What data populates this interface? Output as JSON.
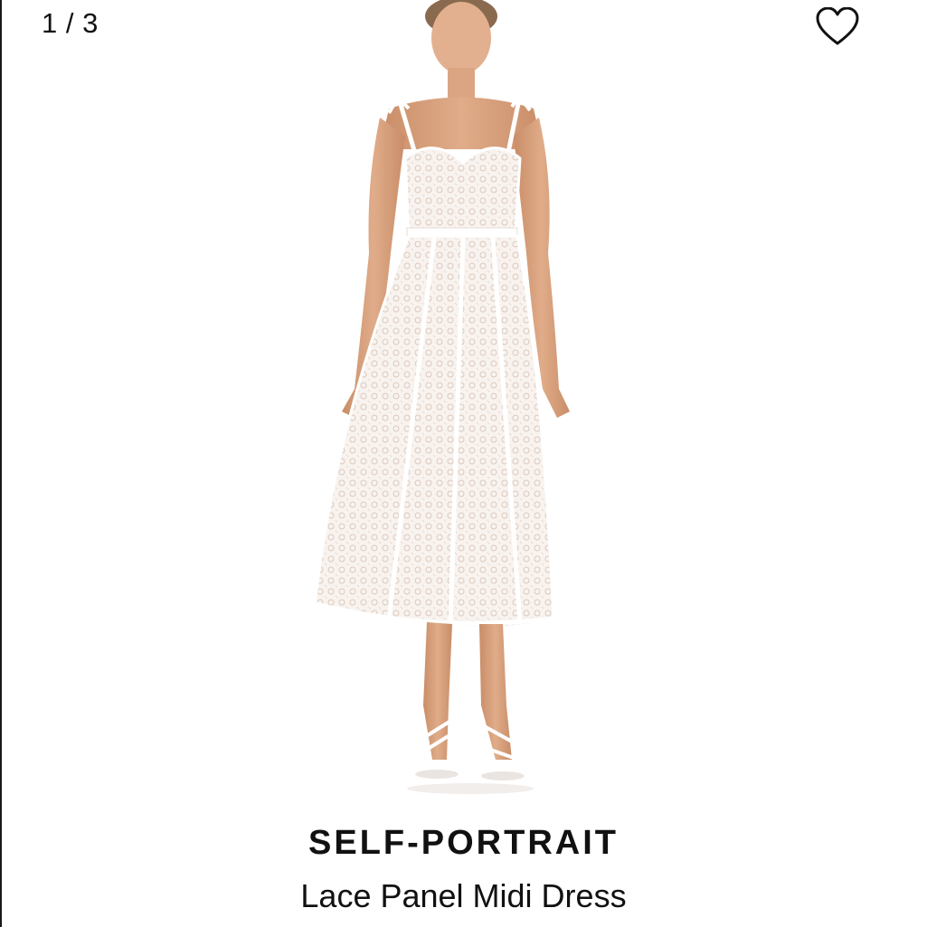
{
  "gallery": {
    "counter": "1 / 3"
  },
  "wishlist": {
    "icon": "heart-outline-icon"
  },
  "product": {
    "brand": "SELF-PORTRAIT",
    "name": "Lace Panel Midi Dress",
    "image_alt": "Model wearing white lace panel midi dress with white strappy sandals"
  },
  "colors": {
    "background": "#ffffff",
    "text": "#111111",
    "dress": "#f7f1ec",
    "skin": "#d8a27e"
  }
}
